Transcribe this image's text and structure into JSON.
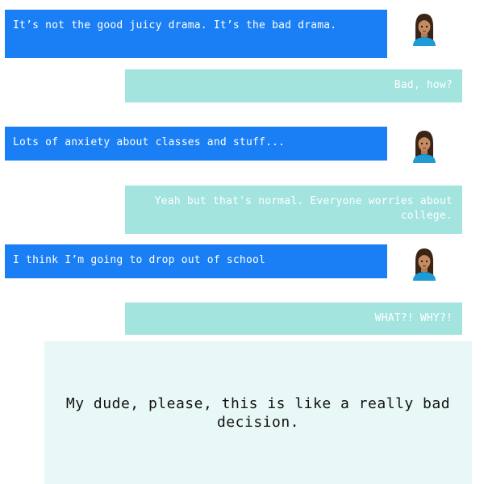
{
  "conversation": {
    "messages": [
      {
        "sender": "friend",
        "text": "It’s not the good juicy drama. It’s the bad drama.",
        "avatar_icon": "woman-avatar-icon"
      },
      {
        "sender": "user",
        "text": "Bad, how?"
      },
      {
        "sender": "friend",
        "text": "Lots of anxiety about classes and stuff...",
        "avatar_icon": "woman-avatar-icon"
      },
      {
        "sender": "user",
        "text": "Yeah but that's normal. Everyone worries about college."
      },
      {
        "sender": "friend",
        "text": "I think I’m going to drop out of school",
        "avatar_icon": "woman-avatar-icon"
      },
      {
        "sender": "user",
        "text": "WHAT?! WHY?!"
      }
    ]
  },
  "reply_option": {
    "text": "My dude, please, this is like a really bad decision."
  },
  "colors": {
    "friend_bubble": "#1a7ff5",
    "user_bubble": "#a3e4df",
    "reply_box": "#e8f8f7"
  }
}
